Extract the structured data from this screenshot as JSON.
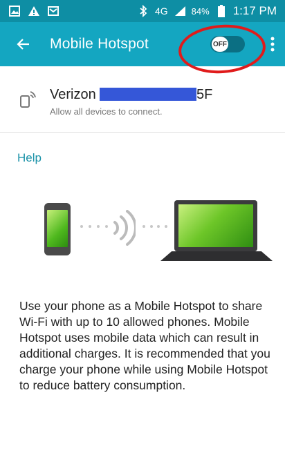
{
  "status_bar": {
    "left_icons": [
      "image-icon",
      "warning-icon",
      "mail-icon"
    ],
    "bluetooth_icon": "bluetooth-icon",
    "network_label": "4G",
    "signal_icon": "signal-icon",
    "battery_percent": "84%",
    "time": "1:17 PM"
  },
  "app_bar": {
    "title": "Mobile Hotspot",
    "toggle_label": "OFF",
    "toggle_on": false
  },
  "network": {
    "name_prefix": "Verizon",
    "name_suffix": "5F",
    "subtitle": "Allow all devices to connect."
  },
  "help_label": "Help",
  "description": "Use your phone as a Mobile Hotspot to share Wi-Fi with up to 10 allowed phones. Mobile Hotspot uses mobile data which can result in additional charges. It is recommended that you charge your phone while using Mobile Hotspot to reduce battery consumption.",
  "colors": {
    "status_bar": "#0e8ea4",
    "app_bar": "#14a6c1",
    "accent_text": "#1a92a8",
    "annotation_ring": "#e01b1b",
    "redaction": "#3557d8"
  }
}
